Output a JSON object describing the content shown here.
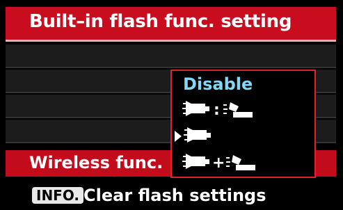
{
  "title": "Built–in flash func. setting",
  "selected_item": {
    "label": "Wireless func."
  },
  "popup": {
    "options": [
      {
        "label": "Disable",
        "icon": null
      },
      {
        "label": "",
        "icon": "flash-colon-slave-icon"
      },
      {
        "label": "",
        "icon": "flash-only-icon"
      },
      {
        "label": "",
        "icon": "flash-plus-slave-icon"
      }
    ],
    "highlighted_index": 2
  },
  "footer": {
    "key": "INFO.",
    "text": "Clear flash settings"
  },
  "colors": {
    "accent": "#c80d1e",
    "option_text": "#7fd8f5",
    "popup_border": "#e3212a"
  }
}
